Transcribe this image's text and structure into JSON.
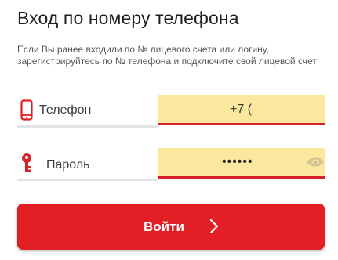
{
  "title": "Вход по номеру телефона",
  "description": "Если Вы ранее входили по № лицевого счета или логину, зарегистрируйтесь по № телефона и подключите свой лицевой счет",
  "phone": {
    "label": "Телефон",
    "icon": "phone-icon",
    "value": "+7 ("
  },
  "password": {
    "label": "Пароль",
    "icon": "key-icon",
    "value": "••••••",
    "toggle_icon": "eye-icon"
  },
  "login_button": {
    "label": "Войти",
    "icon": "chevron-right-icon"
  },
  "colors": {
    "accent": "#e31e25",
    "input_background": "#fbe79e",
    "underline": "#d7242a"
  }
}
